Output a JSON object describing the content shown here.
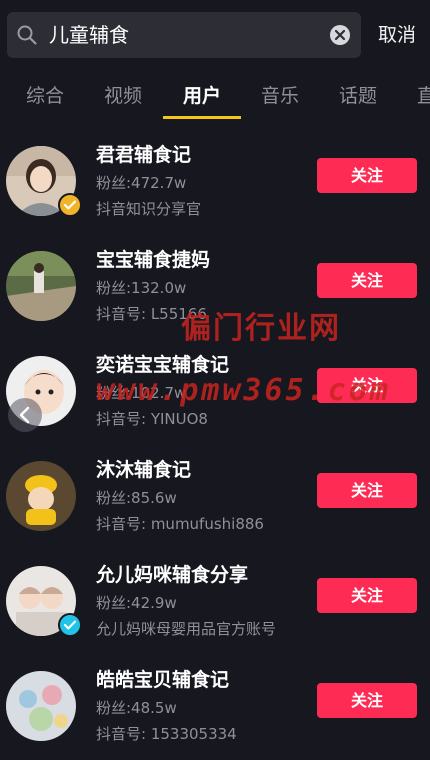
{
  "search": {
    "query": "儿童辅食",
    "cancel_label": "取消"
  },
  "tabs": [
    {
      "label": "综合"
    },
    {
      "label": "视频"
    },
    {
      "label": "用户",
      "active": true
    },
    {
      "label": "音乐"
    },
    {
      "label": "话题"
    },
    {
      "label": "直"
    }
  ],
  "users": [
    {
      "name": "君君辅食记",
      "fans": "粉丝:472.7w",
      "sub": "抖音知识分享官",
      "verified": true,
      "badge_color": "#f0b429",
      "follow_label": "关注"
    },
    {
      "name": "宝宝辅食捷妈",
      "fans": "粉丝:132.0w",
      "sub": "抖音号: L55166",
      "verified": false,
      "follow_label": "关注"
    },
    {
      "name": "奕诺宝宝辅食记",
      "fans": "粉丝:102.7w",
      "sub": "抖音号: YINUO8",
      "verified": false,
      "follow_label": "关注"
    },
    {
      "name": "沐沐辅食记",
      "fans": "粉丝:85.6w",
      "sub": "抖音号: mumufushi886",
      "verified": false,
      "follow_label": "关注"
    },
    {
      "name": "允儿妈咪辅食分享",
      "fans": "粉丝:42.9w",
      "sub": "允儿妈咪母婴用品官方账号",
      "verified": true,
      "badge_color": "#20c4e8",
      "follow_label": "关注"
    },
    {
      "name": "皓皓宝贝辅食记",
      "fans": "粉丝:48.5w",
      "sub": "抖音号: 153305334",
      "verified": false,
      "follow_label": "关注"
    }
  ],
  "watermark": {
    "line1": "偏门行业网",
    "line2": "www.pmw365.com"
  },
  "colors": {
    "background": "#16171f",
    "follow_button": "#fe2c55",
    "tab_indicator": "#f5c518"
  }
}
